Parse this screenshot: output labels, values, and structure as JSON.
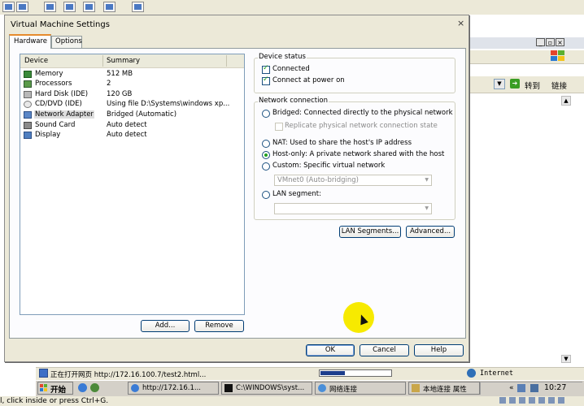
{
  "dialog": {
    "title": "Virtual Machine Settings",
    "close_glyph": "×",
    "tabs": [
      "Hardware",
      "Options"
    ]
  },
  "device_list": {
    "headers": {
      "device": "Device",
      "summary": "Summary"
    },
    "rows": [
      {
        "device": "Memory",
        "summary": "512 MB",
        "icon": "memory-icon"
      },
      {
        "device": "Processors",
        "summary": "2",
        "icon": "processor-icon"
      },
      {
        "device": "Hard Disk (IDE)",
        "summary": "120 GB",
        "icon": "hard-disk-icon"
      },
      {
        "device": "CD/DVD (IDE)",
        "summary": "Using file D:\\Systems\\windows xp...",
        "icon": "cd-dvd-icon"
      },
      {
        "device": "Network Adapter",
        "summary": "Bridged (Automatic)",
        "icon": "network-adapter-icon"
      },
      {
        "device": "Sound Card",
        "summary": "Auto detect",
        "icon": "sound-card-icon"
      },
      {
        "device": "Display",
        "summary": "Auto detect",
        "icon": "display-icon"
      }
    ],
    "add_label": "Add...",
    "remove_label": "Remove"
  },
  "device_status": {
    "title": "Device status",
    "connected_label": "Connected",
    "connect_power_label": "Connect at power on"
  },
  "network_connection": {
    "title": "Network connection",
    "bridged_label": "Bridged: Connected directly to the physical network",
    "replicate_label": "Replicate physical network connection state",
    "nat_label": "NAT: Used to share the host's IP address",
    "host_only_label": "Host-only: A private network shared with the host",
    "custom_label": "Custom: Specific virtual network",
    "custom_value": "VMnet0 (Auto-bridging)",
    "lan_label": "LAN segment:",
    "lan_value": "",
    "lan_segments_btn": "LAN Segments...",
    "advanced_btn": "Advanced..."
  },
  "footer": {
    "ok": "OK",
    "cancel": "Cancel",
    "help": "Help"
  },
  "browser": {
    "goto": "转到",
    "links": "链接",
    "status_text": "正在打开网页 http://172.16.100.7/test2.html...",
    "zone": "Internet",
    "progress": 0.35
  },
  "taskbar": {
    "start": "开始",
    "tasks": [
      "http://172.16.1...",
      "C:\\WINDOWS\\syst...",
      "网络连接",
      "本地连接 属性"
    ],
    "clock": "10:27"
  },
  "hint": "l, click inside or press Ctrl+G."
}
